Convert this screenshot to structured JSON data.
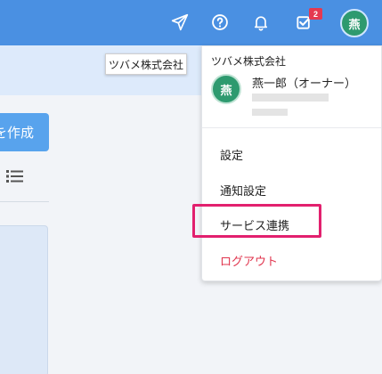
{
  "tooltip": {
    "text": "ツバメ株式会社"
  },
  "topbar": {
    "notification_count": "2",
    "user_initial": "燕",
    "icons": [
      "send-icon",
      "help-icon",
      "bell-icon",
      "task-check-icon",
      "avatar"
    ]
  },
  "main": {
    "create_button_label": "を作成"
  },
  "dropdown": {
    "company": "ツバメ株式会社",
    "avatar_initial": "燕",
    "user_name": "燕一郎（オーナー）",
    "items": [
      {
        "label": "設定"
      },
      {
        "label": "通知設定"
      },
      {
        "label": "サービス連携"
      },
      {
        "label": "ログアウト"
      }
    ]
  },
  "colors": {
    "topbar": "#4a90e2",
    "avatar": "#2e9a6f",
    "badge": "#e53950",
    "highlight": "#e2206e",
    "logout": "#e0344d"
  }
}
